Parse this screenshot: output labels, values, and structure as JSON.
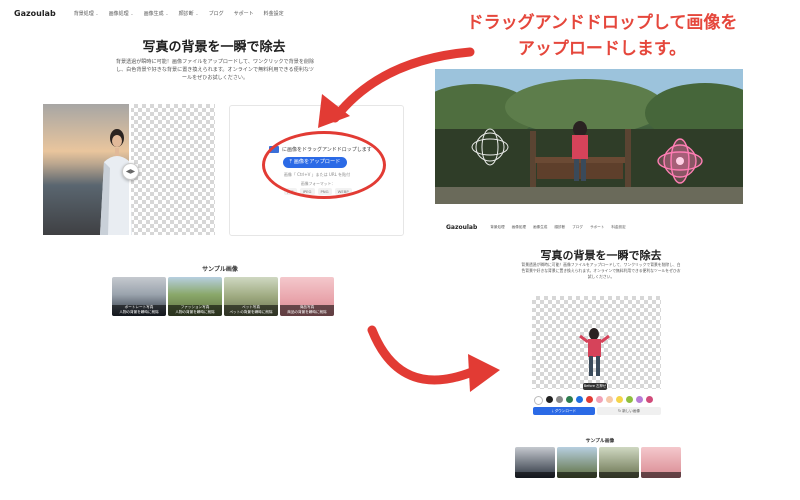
{
  "headline": {
    "line1": "ドラッグアンドドロップして画像を",
    "line2": "アップロードします。"
  },
  "left_screen": {
    "logo": "Gazoulab",
    "nav": [
      {
        "label": "背景処理",
        "has_menu": true
      },
      {
        "label": "画像処理",
        "has_menu": true
      },
      {
        "label": "画像生成",
        "has_menu": true
      },
      {
        "label": "顔診断",
        "has_menu": true
      },
      {
        "label": "ブログ",
        "has_menu": false
      },
      {
        "label": "サポート",
        "has_menu": false
      },
      {
        "label": "料金設定",
        "has_menu": false
      }
    ],
    "title": "写真の背景を一瞬で除去",
    "description": "背景透過が瞬時に可能！画像ファイルをアップロードして、ワンクリックで背景を削除し、白色背景や好きな背景に置き換えられます。オンラインで無料利用できる便利なツールをぜひお試しください。",
    "upload": {
      "drop_text": "に画像をドラッグアンドドロップします",
      "button_label": "画像をアップロード",
      "paste_note": "画像「 Ctrl+V 」または URL を貼付",
      "format_label": "画像フォーマット：",
      "formats": [
        "JPG",
        "JPEG",
        "PNG",
        "WEBP"
      ]
    },
    "samples_title": "サンプル画像",
    "samples": [
      {
        "caption": "ポートレート写真",
        "sub": "人物の背景を瞬時に削除"
      },
      {
        "caption": "ファッション写真",
        "sub": "人物の背景を瞬時に削除"
      },
      {
        "caption": "ペット写真",
        "sub": "ペットの背景を瞬時に削除"
      },
      {
        "caption": "商品写真",
        "sub": "商品の背景を瞬時に削除"
      }
    ]
  },
  "right_screen": {
    "logo": "Gazoulab",
    "nav": [
      "背景処理",
      "画像処理",
      "画像生成",
      "顔診断",
      "ブログ",
      "サポート",
      "料金設定"
    ],
    "title": "写真の背景を一瞬で除去",
    "description": "背景透過が瞬時に可能！画像ファイルをアップロードして、ワンクリックで背景を削除し、白色背景や好きな背景に置き換えられます。オンラインで無料利用できる便利なツールをぜひお試しください。",
    "tooltip": "Before 左押せ",
    "swatch_colors": [
      "#ffffff",
      "#222222",
      "#8a8a8a",
      "#2e7d4f",
      "#1f6fe0",
      "#e23b34",
      "#f2a3b6",
      "#f6c9a8",
      "#f5d44a",
      "#8fbf3f",
      "#b67dd6",
      "#d14b7a"
    ],
    "download_label": "ダウンロード",
    "new_image_label": "新しい画像",
    "samples_title": "サンプル画像"
  },
  "colors": {
    "accent_red": "#e5473c",
    "primary_blue": "#2b6ae6"
  }
}
